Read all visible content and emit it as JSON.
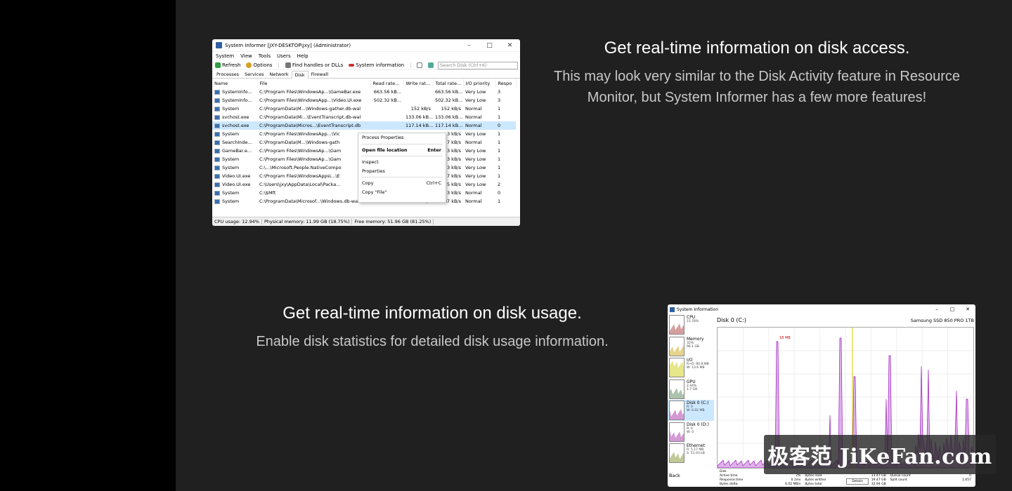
{
  "section1": {
    "title": "Get real-time information on disk access.",
    "desc_line1": "This may look very similar to the Disk Activity feature in Resource",
    "desc_line2": "Monitor, but System Informer has a few more features!"
  },
  "section2": {
    "title": "Get real-time information on disk usage.",
    "desc": "Enable disk statistics for detailed disk usage information."
  },
  "si_window": {
    "title": "System Informer [JXY-DESKTOP\\jxy] (Administrator)",
    "menu": [
      "System",
      "View",
      "Tools",
      "Users",
      "Help"
    ],
    "toolbar": {
      "refresh": "Refresh",
      "options": "Options",
      "find": "Find handles or DLLs",
      "sysinfo": "System information"
    },
    "search_placeholder": "Search Disk (Ctrl+K)",
    "tabs": [
      "Processes",
      "Services",
      "Network",
      "Disk",
      "Firewall"
    ],
    "active_tab": "Disk",
    "columns": [
      "Name",
      "File",
      "Read rate...",
      "Write rat...",
      "Total rate...",
      "I/O priority",
      "Respo"
    ],
    "rows": [
      {
        "name": "SystemInfo...",
        "file": "C:\\Program Files\\WindowsAp...\\GameBar.exe",
        "read": "663.56 kB...",
        "write": "",
        "total": "663.56 kB...",
        "prio": "Very Low",
        "resp": "3",
        "sel": false
      },
      {
        "name": "SystemInfo...",
        "file": "C:\\Program Files\\WindowsApp...\\Video.UI.exe",
        "read": "502.32 kB...",
        "write": "",
        "total": "502.32 kB...",
        "prio": "Very Low",
        "resp": "3",
        "sel": false
      },
      {
        "name": "System",
        "file": "C:\\ProgramData\\M...\\Windows-gather.db-wal",
        "read": "",
        "write": "152 kB/s",
        "total": "152 kB/s",
        "prio": "Normal",
        "resp": "1",
        "sel": false
      },
      {
        "name": "svchost.exe",
        "file": "C:\\ProgramData\\Mi...\\EventTranscript.db-wal",
        "read": "",
        "write": "133.06 kB...",
        "total": "133.06 kB...",
        "prio": "Normal",
        "resp": "1",
        "sel": false
      },
      {
        "name": "svchost.exe",
        "file": "C:\\ProgramData\\Micros...\\EventTranscript.db",
        "read": "",
        "write": "117.14 kB...",
        "total": "117.14 kB...",
        "prio": "Normal",
        "resp": "0",
        "sel": true
      },
      {
        "name": "System",
        "file": "C:\\Program Files\\WindowsApp...\\Vic",
        "read": "",
        "write": "",
        "total": "3 kB/s",
        "prio": "Very Low",
        "resp": "1",
        "sel": false
      },
      {
        "name": "SearchInde...",
        "file": "C:\\ProgramData\\M...\\Windows-gath",
        "read": "",
        "write": "",
        "total": "7 kB/s",
        "prio": "Normal",
        "resp": "1",
        "sel": false
      },
      {
        "name": "GameBar.e...",
        "file": "C:\\Program Files\\WindowsAp...\\Gam",
        "read": "",
        "write": "",
        "total": "3 kB/s",
        "prio": "Very Low",
        "resp": "1",
        "sel": false
      },
      {
        "name": "System",
        "file": "C:\\Program Files\\WindowsAp...\\Gam",
        "read": "",
        "write": "",
        "total": "3 kB/s",
        "prio": "Very Low",
        "resp": "1",
        "sel": false
      },
      {
        "name": "System",
        "file": "C:\\...\\Microsoft.People.NativeCompo",
        "read": "",
        "write": "",
        "total": "3 kB/s",
        "prio": "Very Low",
        "resp": "1",
        "sel": false
      },
      {
        "name": "Video.UI.exe",
        "file": "C:\\Program Files\\WindowsApps\\...\\E",
        "read": "",
        "write": "",
        "total": "7 kB/s",
        "prio": "Very Low",
        "resp": "1",
        "sel": false
      },
      {
        "name": "Video.UI.exe",
        "file": "C:\\Users\\jxy\\AppData\\Local\\Packa...",
        "read": "",
        "write": "",
        "total": "5 kB/s",
        "prio": "Very Low",
        "resp": "2",
        "sel": false
      },
      {
        "name": "System",
        "file": "C:\\$Mft",
        "read": "",
        "write": "",
        "total": "3 kB/s",
        "prio": "Normal",
        "resp": "0",
        "sel": false
      },
      {
        "name": "System",
        "file": "C:\\ProgramData\\Microsof...\\Windows.db-wal",
        "read": "",
        "write": "54.87 kB/s",
        "total": "54.87 kB/s",
        "prio": "Normal",
        "resp": "1",
        "sel": false
      }
    ],
    "context_menu": [
      {
        "label": "Process Properties",
        "shortcut": "",
        "bold": false
      },
      {
        "sep": true
      },
      {
        "label": "Open file location",
        "shortcut": "Enter",
        "bold": true
      },
      {
        "sep": true
      },
      {
        "label": "Inspect",
        "shortcut": "",
        "bold": false
      },
      {
        "label": "Properties",
        "shortcut": "",
        "bold": false
      },
      {
        "sep": true
      },
      {
        "label": "Copy",
        "shortcut": "Ctrl+C",
        "bold": false
      },
      {
        "label": "Copy \"File\"",
        "shortcut": "",
        "bold": false
      }
    ],
    "status": {
      "cpu": "CPU usage: 12.94%",
      "phys": "Physical memory: 11.99 GB (18.75%)",
      "free": "Free memory: 51.96 GB (81.25%)"
    }
  },
  "du_window": {
    "title": "System Information",
    "sidebar": [
      {
        "label": "CPU",
        "sub1": "15.78%",
        "sub2": "",
        "color": "#a52a2a",
        "active": false
      },
      {
        "label": "Memory",
        "sub1": "32%",
        "sub2": "96.1 GB",
        "color": "#c8a000",
        "active": false
      },
      {
        "label": "I/O",
        "sub1": "R+O: 90.9 MB",
        "sub2": "W: 13.6 MB",
        "color": "#c8c800",
        "active": false
      },
      {
        "label": "GPU",
        "sub1": "2.44%",
        "sub2": "1.7 GB",
        "color": "#4a7a4a",
        "active": false
      },
      {
        "label": "Disk 0 (C:)",
        "sub1": "R: 0",
        "sub2": "W: 6.02 MB",
        "color": "#a020a0",
        "active": true
      },
      {
        "label": "Disk 0 (D:)",
        "sub1": "R: 0",
        "sub2": "W: 0",
        "color": "#a020a0",
        "active": false
      },
      {
        "label": "Ethernet",
        "sub1": "R: 5.17 MB",
        "sub2": "S: 51.03 kB",
        "color": "#7a8a20",
        "active": false
      }
    ],
    "back": "Back",
    "pane_title": "Disk 0 (C:)",
    "pane_model": "Samsung SSD 850 PRO 1TB",
    "peak_label": "18 MB",
    "stats": [
      {
        "k": "Disk",
        "v": ""
      },
      {
        "k": "",
        "v": ""
      },
      {
        "k": "",
        "v": ""
      },
      {
        "k": "Active time",
        "v": "2%"
      },
      {
        "k": "Bytes read",
        "v": "13.47 GB"
      },
      {
        "k": "Queue count",
        "v": "0"
      },
      {
        "k": "Response time",
        "v": "0.1ms"
      },
      {
        "k": "Bytes written",
        "v": "19.47 GB"
      },
      {
        "k": "Split count",
        "v": "1,657"
      },
      {
        "k": "Bytes delta",
        "v": "6.02 MB/s"
      },
      {
        "k": "Bytes total",
        "v": "32.94 GB"
      },
      {
        "k": "",
        "v": ""
      }
    ],
    "details_btn": "Details"
  },
  "watermark": "极客范 JiKeFan.com",
  "colors": {
    "bg": "#202020",
    "strip": "#000000",
    "desc": "#c8c8c8",
    "select": "#cce8ff",
    "disk_series": "#a020c0"
  }
}
